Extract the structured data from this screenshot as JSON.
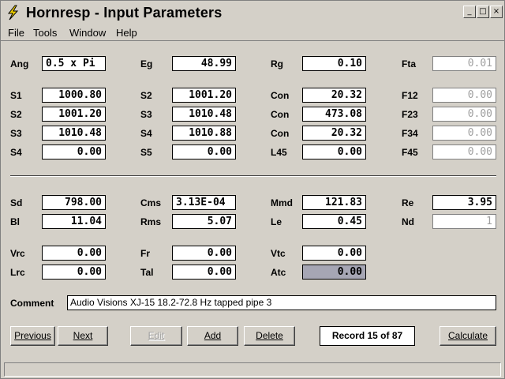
{
  "window": {
    "title": "Hornresp - Input Parameters",
    "controls": {
      "minimize": "_",
      "maximize": "□",
      "close": "×"
    }
  },
  "menu": [
    "File",
    "Tools",
    "Window",
    "Help"
  ],
  "rows_top": [
    [
      {
        "label": "Ang",
        "value": "0.5 x Pi",
        "align": "left"
      },
      {
        "label": "Eg",
        "value": "48.99"
      },
      {
        "label": "Rg",
        "value": "0.10"
      },
      {
        "label": "Fta",
        "value": "0.01",
        "disabled": true
      }
    ],
    [
      {
        "label": "S1",
        "value": "1000.80"
      },
      {
        "label": "S2",
        "value": "1001.20"
      },
      {
        "label": "Con",
        "value": "20.32"
      },
      {
        "label": "F12",
        "value": "0.00",
        "disabled": true
      }
    ],
    [
      {
        "label": "S2",
        "value": "1001.20"
      },
      {
        "label": "S3",
        "value": "1010.48"
      },
      {
        "label": "Con",
        "value": "473.08"
      },
      {
        "label": "F23",
        "value": "0.00",
        "disabled": true
      }
    ],
    [
      {
        "label": "S3",
        "value": "1010.48"
      },
      {
        "label": "S4",
        "value": "1010.88"
      },
      {
        "label": "Con",
        "value": "20.32"
      },
      {
        "label": "F34",
        "value": "0.00",
        "disabled": true
      }
    ],
    [
      {
        "label": "S4",
        "value": "0.00"
      },
      {
        "label": "S5",
        "value": "0.00"
      },
      {
        "label": "L45",
        "value": "0.00"
      },
      {
        "label": "F45",
        "value": "0.00",
        "disabled": true
      }
    ]
  ],
  "rows_bottom": [
    [
      {
        "label": "Sd",
        "value": "798.00"
      },
      {
        "label": "Cms",
        "value": "3.13E-04",
        "align": "left"
      },
      {
        "label": "Mmd",
        "value": "121.83"
      },
      {
        "label": "Re",
        "value": "3.95"
      }
    ],
    [
      {
        "label": "Bl",
        "value": "11.04"
      },
      {
        "label": "Rms",
        "value": "5.07"
      },
      {
        "label": "Le",
        "value": "0.45"
      },
      {
        "label": "Nd",
        "value": "1",
        "disabled": true
      }
    ],
    [
      {
        "label": "Vrc",
        "value": "0.00"
      },
      {
        "label": "Fr",
        "value": "0.00"
      },
      {
        "label": "Vtc",
        "value": "0.00"
      }
    ],
    [
      {
        "label": "Lrc",
        "value": "0.00"
      },
      {
        "label": "Tal",
        "value": "0.00"
      },
      {
        "label": "Atc",
        "value": "0.00",
        "selected": true
      }
    ]
  ],
  "comment": {
    "label": "Comment",
    "value": "Audio Visions XJ-15 18.2-72.8 Hz tapped pipe 3"
  },
  "buttons": {
    "previous": "Previous",
    "next": "Next",
    "edit": "Edit",
    "add": "Add",
    "delete": "Delete",
    "calculate": "Calculate"
  },
  "record": "Record 15 of 87",
  "colors": {
    "face": "#d4d0c8",
    "field_bg": "#ffffff",
    "disabled_text": "#a0a0a0",
    "selection": "#a6a6b4",
    "icon_yellow": "#f0d000"
  }
}
